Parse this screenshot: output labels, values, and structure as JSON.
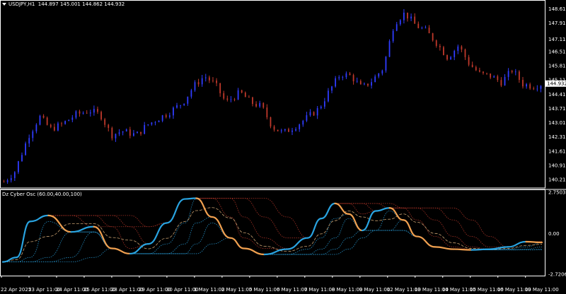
{
  "main": {
    "symbol": "USDJPY,H1",
    "ohlc": "144.897 145.001 144.862 144.932",
    "price_axis": [
      "148.610",
      "147.910",
      "147.110",
      "146.510",
      "145.810",
      "145.110",
      "144.410",
      "143.710",
      "143.010",
      "142.310",
      "141.610",
      "140.910",
      "140.210"
    ],
    "current_price": "144.932",
    "colors": {
      "bull": "#2f3cff",
      "bear": "#c0392b",
      "price_label_bg": "#ffffff"
    }
  },
  "oscillator": {
    "title": "Dz Cyber Osc (60.00,40.00,100)",
    "axis": [
      "2.7503",
      "0.00",
      "-2.7206"
    ]
  },
  "time_axis": [
    "22 Apr 2025",
    "23 Apr 11:00",
    "24 Apr 11:00",
    "25 Apr 11:00",
    "28 Apr 11:00",
    "29 Apr 11:00",
    "30 Apr 11:00",
    "1 May 11:00",
    "2 May 11:00",
    "5 May 11:00",
    "6 May 11:00",
    "7 May 11:00",
    "8 May 11:00",
    "9 May 11:00",
    "12 May 11:00",
    "13 May 11:00",
    "14 May 11:00",
    "15 May 11:00",
    "16 May 11:00",
    "19 May 11:00"
  ],
  "chart_data": [
    {
      "type": "candlestick",
      "ylim": [
        139.8,
        148.9
      ],
      "price_path": [
        [
          0,
          140.1
        ],
        [
          3,
          140.6
        ],
        [
          7,
          142.4
        ],
        [
          10,
          143.3
        ],
        [
          13,
          142.7
        ],
        [
          16,
          142.9
        ],
        [
          20,
          143.4
        ],
        [
          24,
          143.6
        ],
        [
          27,
          143.4
        ],
        [
          30,
          142.4
        ],
        [
          33,
          142.6
        ],
        [
          37,
          142.4
        ],
        [
          40,
          142.9
        ],
        [
          43,
          143.2
        ],
        [
          46,
          143.5
        ],
        [
          50,
          144.0
        ],
        [
          53,
          144.8
        ],
        [
          56,
          145.3
        ],
        [
          59,
          144.9
        ],
        [
          62,
          144.0
        ],
        [
          66,
          144.5
        ],
        [
          69,
          144.0
        ],
        [
          72,
          143.8
        ],
        [
          75,
          142.8
        ],
        [
          78,
          142.5
        ],
        [
          82,
          142.9
        ],
        [
          85,
          143.3
        ],
        [
          88,
          143.7
        ],
        [
          91,
          144.6
        ],
        [
          94,
          145.4
        ],
        [
          97,
          145.3
        ],
        [
          100,
          144.7
        ],
        [
          103,
          145.1
        ],
        [
          106,
          145.7
        ],
        [
          109,
          147.9
        ],
        [
          112,
          148.4
        ],
        [
          115,
          147.8
        ],
        [
          118,
          147.5
        ],
        [
          121,
          146.9
        ],
        [
          124,
          146.2
        ],
        [
          127,
          146.8
        ],
        [
          130,
          145.9
        ],
        [
          133,
          145.4
        ],
        [
          136,
          145.3
        ],
        [
          139,
          145.0
        ],
        [
          142,
          145.6
        ],
        [
          145,
          144.9
        ],
        [
          148,
          144.8
        ],
        [
          150,
          144.9
        ]
      ],
      "bars": 150
    },
    {
      "type": "line",
      "ylim": [
        -2.7206,
        2.7503
      ],
      "series": [
        {
          "color": "#29a3e0",
          "values": [
            [
              0,
              -1.9
            ],
            [
              6,
              -1.6
            ],
            [
              12,
              0.8
            ],
            [
              20,
              1.2
            ],
            [
              30,
              0.1
            ],
            [
              40,
              0.45
            ],
            [
              48,
              -1.0
            ],
            [
              56,
              -1.35
            ],
            [
              64,
              -0.7
            ],
            [
              72,
              0.7
            ],
            [
              80,
              2.3
            ],
            [
              85,
              2.35
            ],
            [
              92,
              1.1
            ],
            [
              100,
              -0.3
            ],
            [
              106,
              -1.0
            ],
            [
              115,
              -1.4
            ],
            [
              125,
              -1.05
            ],
            [
              134,
              -0.3
            ],
            [
              140,
              1.0
            ],
            [
              146,
              2.0
            ],
            [
              152,
              1.3
            ],
            [
              158,
              0.2
            ],
            [
              164,
              1.5
            ],
            [
              170,
              1.7
            ],
            [
              176,
              0.9
            ],
            [
              182,
              -0.2
            ],
            [
              190,
              -0.9
            ],
            [
              198,
              -1.05
            ],
            [
              206,
              -1.1
            ],
            [
              214,
              -1.05
            ],
            [
              222,
              -0.9
            ],
            [
              230,
              -0.55
            ],
            [
              237,
              -0.6
            ]
          ]
        },
        {
          "color": "#f0a050",
          "values": [
            [
              0,
              -1.9
            ],
            [
              6,
              -1.6
            ],
            [
              12,
              0.8
            ],
            [
              20,
              1.2
            ],
            [
              30,
              0.1
            ],
            [
              40,
              0.45
            ],
            [
              48,
              -1.0
            ],
            [
              56,
              -1.35
            ],
            [
              64,
              -0.7
            ],
            [
              72,
              0.7
            ],
            [
              80,
              2.3
            ],
            [
              85,
              2.35
            ],
            [
              92,
              1.1
            ],
            [
              100,
              -0.3
            ],
            [
              106,
              -1.0
            ],
            [
              115,
              -1.4
            ],
            [
              125,
              -1.05
            ],
            [
              134,
              -0.3
            ],
            [
              140,
              1.0
            ],
            [
              146,
              2.0
            ],
            [
              152,
              1.3
            ],
            [
              158,
              0.2
            ],
            [
              164,
              1.5
            ],
            [
              170,
              1.7
            ],
            [
              176,
              0.9
            ],
            [
              182,
              -0.2
            ],
            [
              190,
              -0.9
            ],
            [
              198,
              -1.05
            ],
            [
              206,
              -1.1
            ],
            [
              214,
              -1.05
            ],
            [
              222,
              -0.9
            ],
            [
              230,
              -0.55
            ],
            [
              237,
              -0.6
            ]
          ]
        }
      ],
      "upper_bands": {
        "color": "#c0392b",
        "count": 4
      },
      "lower_bands": {
        "color": "#29a3e0",
        "count": 4
      },
      "mid_band": {
        "color": "#c8a070"
      }
    }
  ]
}
